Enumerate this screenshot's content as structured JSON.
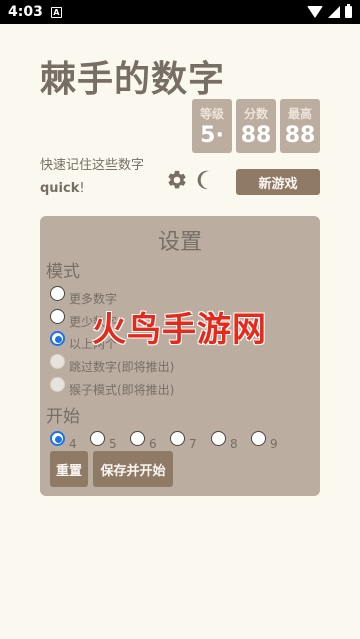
{
  "status_bar": {
    "time": "4:03",
    "notif_icon": "A"
  },
  "app": {
    "title": "棘手的数字",
    "subtitle": "快速记住这些数字",
    "mode_text": "quick",
    "mode_suffix": "!",
    "new_game": "新游戏"
  },
  "scores": [
    {
      "label": "等级",
      "value": "5·"
    },
    {
      "label": "分数",
      "value": "88"
    },
    {
      "label": "最高",
      "value": "88"
    }
  ],
  "settings": {
    "title": "设置",
    "mode_label": "模式",
    "modes": [
      {
        "label": "更多数字",
        "checked": false,
        "disabled": false
      },
      {
        "label": "更少数字",
        "checked": false,
        "disabled": false
      },
      {
        "label": "以上两个",
        "checked": true,
        "disabled": false
      },
      {
        "label": "跳过数字(即将推出)",
        "checked": false,
        "disabled": true
      },
      {
        "label": "猴子模式(即将推出)",
        "checked": false,
        "disabled": true
      }
    ],
    "start_label": "开始",
    "start_options": [
      "4",
      "5",
      "6",
      "7",
      "8",
      "9"
    ],
    "start_selected": "4",
    "reset_button": "重置",
    "save_button": "保存并开始"
  },
  "watermark": "火鸟手游网",
  "colors": {
    "background": "#fbf8ef",
    "panel": "#bbada0",
    "button": "#8f7a66",
    "text": "#776e65",
    "radio_accent": "#1a73e8"
  }
}
